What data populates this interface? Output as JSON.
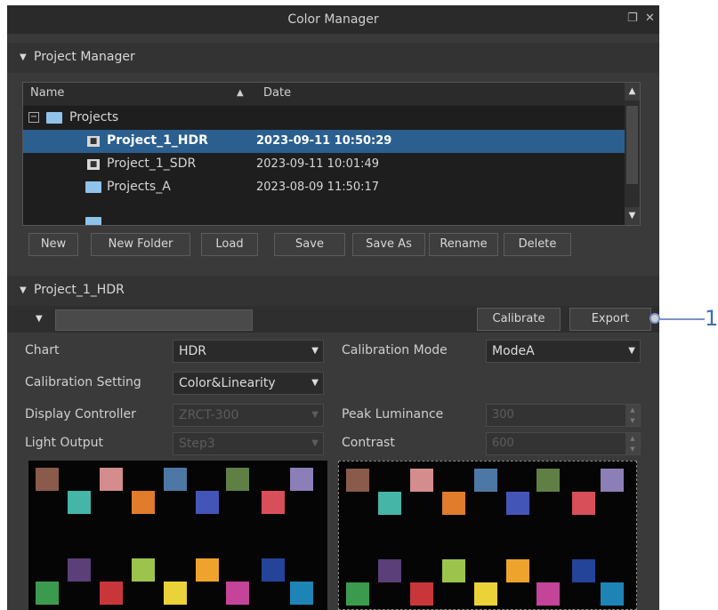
{
  "window": {
    "title": "Color Manager",
    "restore_icon": "restore-icon",
    "close_icon": "close-icon"
  },
  "project_manager": {
    "header": "Project Manager",
    "columns": {
      "name": "Name",
      "date": "Date"
    },
    "root": "Projects",
    "rows": [
      {
        "name": "Project_1_HDR",
        "date": "2023-09-11 10:50:29",
        "selected": true,
        "icon": "project-icon"
      },
      {
        "name": "Project_1_SDR",
        "date": "2023-09-11 10:01:49",
        "selected": false,
        "icon": "project-icon"
      },
      {
        "name": "Projects_A",
        "date": "2023-08-09 11:50:17",
        "selected": false,
        "icon": "folder-icon"
      }
    ],
    "buttons": {
      "new": "New",
      "new_folder": "New Folder",
      "load": "Load",
      "save": "Save",
      "save_as": "Save As",
      "rename": "Rename",
      "delete": "Delete"
    }
  },
  "project": {
    "header": "Project_1_HDR",
    "calibrate": "Calibrate",
    "export": "Export",
    "chart_label": "Chart",
    "chart_value": "HDR",
    "calibration_mode_label": "Calibration Mode",
    "calibration_mode_value": "ModeA",
    "calibration_setting_label": "Calibration Setting",
    "calibration_setting_value": "Color&Linearity",
    "display_controller_label": "Display Controller",
    "display_controller_value": "ZRCT-300",
    "peak_luminance_label": "Peak Luminance",
    "peak_luminance_value": "300",
    "light_output_label": "Light Output",
    "light_output_value": "Step3",
    "contrast_label": "Contrast",
    "contrast_value": "600"
  },
  "colors": {
    "selection": "#2b5f8f",
    "swatches": [
      "#8a5b4a",
      "#d48c8c",
      "#4d78a6",
      "#5f7f45",
      "#8c7fb8",
      "#45b5a8",
      "#e07c2c",
      "#4356b8",
      "#d84f5a",
      "#5a3f78",
      "#9cc44c",
      "#eea42c",
      "#24449a",
      "#3c9a4e",
      "#c8363a",
      "#ecd239",
      "#c4449a",
      "#1e84b6"
    ]
  },
  "callout": {
    "number": "1"
  }
}
